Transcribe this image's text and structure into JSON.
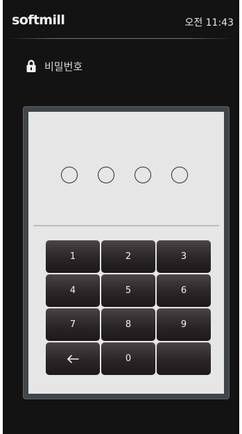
{
  "status_bar": {
    "brand": "softmill",
    "time": "오전 11:43"
  },
  "password_header": {
    "icon": "lock-icon",
    "label": "비밀번호"
  },
  "pin_entry": {
    "length": 4,
    "filled": 0
  },
  "keypad": {
    "keys": [
      "1",
      "2",
      "3",
      "4",
      "5",
      "6",
      "7",
      "8",
      "9",
      "",
      "0",
      ""
    ],
    "backspace_icon": "backspace-arrow-icon"
  },
  "colors": {
    "background": "#131313",
    "card": "#e6e6e6",
    "card_frame": "#3f4549",
    "key": "#2a2527",
    "key_text": "#f0f0f0"
  }
}
